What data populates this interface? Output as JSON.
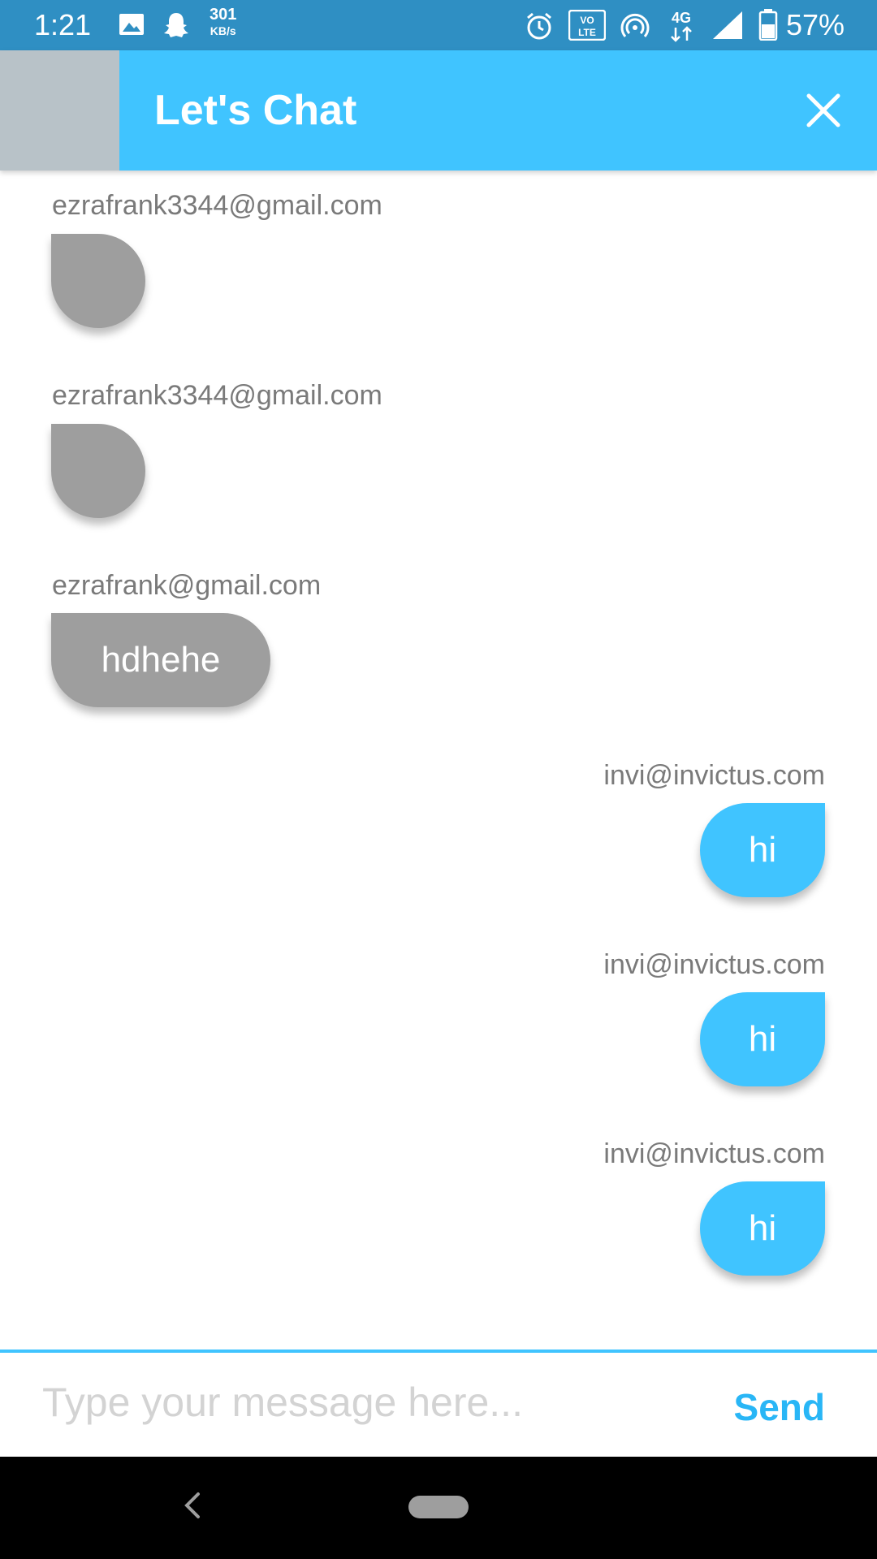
{
  "status_bar": {
    "time": "1:21",
    "speed_value": "301",
    "speed_unit": "KB/s",
    "battery_percent": "57%",
    "icons": [
      "image-icon",
      "snapchat-icon",
      "alarm-icon",
      "volte-icon",
      "hotspot-icon",
      "4g-icon",
      "signal-icon",
      "battery-icon"
    ]
  },
  "header": {
    "title": "Let's Chat",
    "close_icon": "close-icon",
    "accent_color": "#40c4ff"
  },
  "messages": [
    {
      "sender": "ezrafrank3344@gmail.com",
      "text": "",
      "side": "left"
    },
    {
      "sender": "ezrafrank3344@gmail.com",
      "text": "",
      "side": "left"
    },
    {
      "sender": "ezrafrank@gmail.com",
      "text": "hdhehe",
      "side": "left"
    },
    {
      "sender": "invi@invictus.com",
      "text": "hi",
      "side": "right"
    },
    {
      "sender": "invi@invictus.com",
      "text": "hi",
      "side": "right"
    },
    {
      "sender": "invi@invictus.com",
      "text": "hi",
      "side": "right"
    }
  ],
  "composer": {
    "placeholder": "Type your message here...",
    "value": "",
    "send_label": "Send"
  },
  "colors": {
    "incoming_bubble": "#9e9e9e",
    "outgoing_bubble": "#40c4ff",
    "status_bar": "#2f8fc3"
  }
}
